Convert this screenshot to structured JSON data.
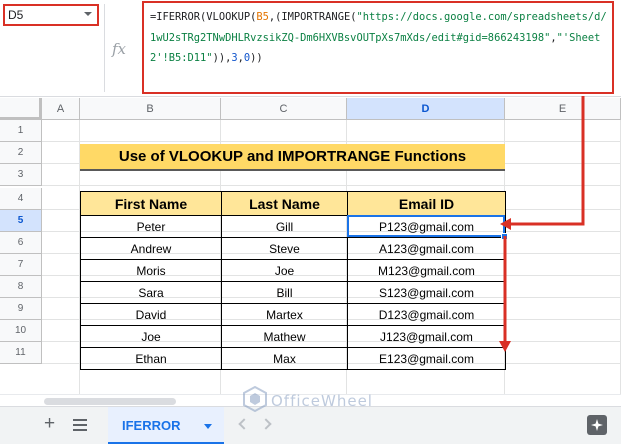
{
  "name_box": {
    "value": "D5"
  },
  "formula_bar": {
    "fx_label": "fx",
    "formula_parts": [
      {
        "text": "=IFERROR(VLOOKUP(",
        "kind": "plain"
      },
      {
        "text": "B5",
        "kind": "ref"
      },
      {
        "text": ",(IMPORTRANGE(",
        "kind": "plain"
      },
      {
        "text": "\"https://docs.google.com/spreadsheets/d/1wU2sTRg2TNwDHLRvzsikZQ-Dm6HXVBsvOUTpXs7mXds/edit#gid=866243198\"",
        "kind": "str"
      },
      {
        "text": ",",
        "kind": "plain"
      },
      {
        "text": "\"'Sheet2'!B5:D11\"",
        "kind": "str"
      },
      {
        "text": ")),",
        "kind": "plain"
      },
      {
        "text": "3",
        "kind": "num"
      },
      {
        "text": ",",
        "kind": "plain"
      },
      {
        "text": "0",
        "kind": "num"
      },
      {
        "text": "))",
        "kind": "plain"
      }
    ]
  },
  "columns": [
    {
      "letter": "A",
      "active": false
    },
    {
      "letter": "B",
      "active": false
    },
    {
      "letter": "C",
      "active": false
    },
    {
      "letter": "D",
      "active": true
    },
    {
      "letter": "E",
      "active": false
    }
  ],
  "rows": [
    {
      "number": "1",
      "active": false
    },
    {
      "number": "2",
      "active": false
    },
    {
      "number": "3",
      "active": false
    },
    {
      "number": "4",
      "active": false
    },
    {
      "number": "5",
      "active": true
    },
    {
      "number": "6",
      "active": false
    },
    {
      "number": "7",
      "active": false
    },
    {
      "number": "8",
      "active": false
    },
    {
      "number": "9",
      "active": false
    },
    {
      "number": "10",
      "active": false
    },
    {
      "number": "11",
      "active": false
    }
  ],
  "sheet": {
    "title": "Use of VLOOKUP and IMPORTRANGE Functions",
    "headers": [
      "First Name",
      "Last Name",
      "Email ID"
    ],
    "rows": [
      [
        "Peter",
        "Gill",
        "P123@gmail.com"
      ],
      [
        "Andrew",
        "Steve",
        "A123@gmail.com"
      ],
      [
        "Moris",
        "Joe",
        "M123@gmail.com"
      ],
      [
        "Sara",
        "Bill",
        "S123@gmail.com"
      ],
      [
        "David",
        "Martex",
        "D123@gmail.com"
      ],
      [
        "Joe",
        "Mathew",
        "J123@gmail.com"
      ],
      [
        "Ethan",
        "Max",
        "E123@gmail.com"
      ]
    ]
  },
  "sheet_tabs": {
    "add_label": "+",
    "active_tab": "IFERROR"
  },
  "watermark": {
    "text": "OfficeWheel"
  },
  "colors": {
    "accent": "#1a73e8",
    "highlight": "#d93025",
    "title_fill": "#ffd966",
    "header_fill": "#ffe699"
  }
}
